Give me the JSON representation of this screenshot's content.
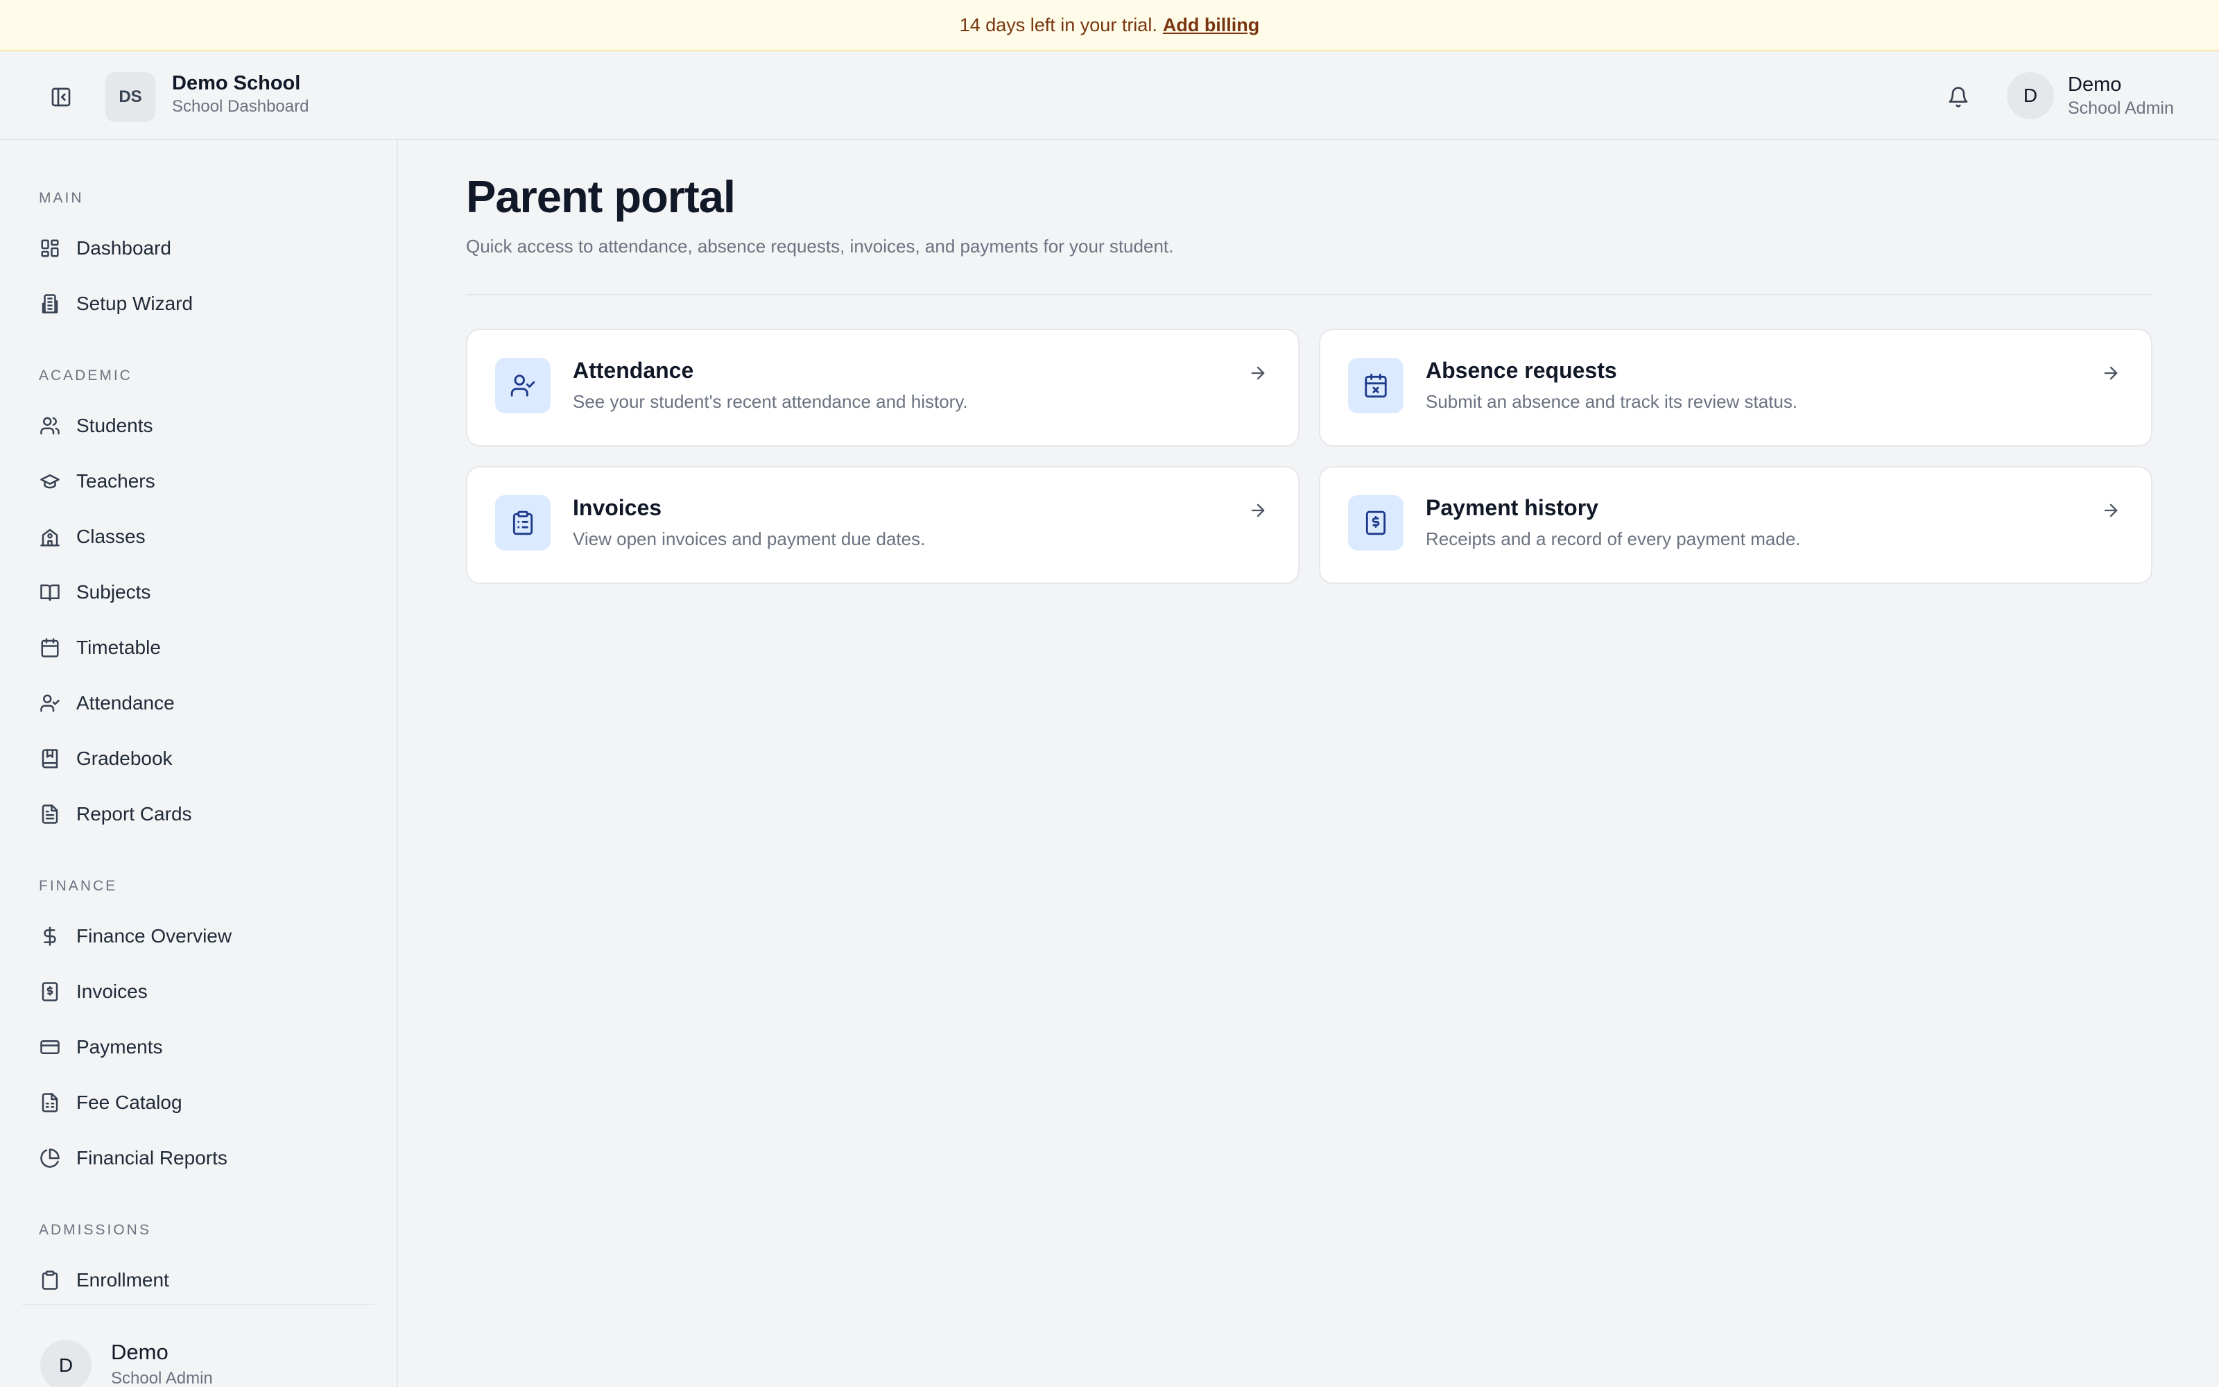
{
  "banner": {
    "text": "14 days left in your trial.",
    "link": "Add billing"
  },
  "header": {
    "collapse_icon": "sidebar-collapse-icon",
    "school_initials": "DS",
    "school_name": "Demo School",
    "school_subtitle": "School Dashboard",
    "bell_icon": "bell-icon",
    "user_initial": "D",
    "user_name": "Demo",
    "user_role": "School Admin"
  },
  "sidebar": {
    "sections": [
      {
        "label": "MAIN",
        "items": [
          {
            "label": "Dashboard",
            "icon": "dashboard-icon"
          },
          {
            "label": "Setup Wizard",
            "icon": "building-icon"
          }
        ]
      },
      {
        "label": "ACADEMIC",
        "items": [
          {
            "label": "Students",
            "icon": "users-icon"
          },
          {
            "label": "Teachers",
            "icon": "graduation-cap-icon"
          },
          {
            "label": "Classes",
            "icon": "school-icon"
          },
          {
            "label": "Subjects",
            "icon": "book-open-icon"
          },
          {
            "label": "Timetable",
            "icon": "calendar-icon"
          },
          {
            "label": "Attendance",
            "icon": "user-check-icon"
          },
          {
            "label": "Gradebook",
            "icon": "bookmark-book-icon"
          },
          {
            "label": "Report Cards",
            "icon": "file-text-icon"
          }
        ]
      },
      {
        "label": "FINANCE",
        "items": [
          {
            "label": "Finance Overview",
            "icon": "dollar-icon"
          },
          {
            "label": "Invoices",
            "icon": "receipt-icon"
          },
          {
            "label": "Payments",
            "icon": "credit-card-icon"
          },
          {
            "label": "Fee Catalog",
            "icon": "file-spreadsheet-icon"
          },
          {
            "label": "Financial Reports",
            "icon": "pie-chart-icon"
          }
        ]
      },
      {
        "label": "ADMISSIONS",
        "items": [
          {
            "label": "Enrollment",
            "icon": "clipboard-icon"
          }
        ]
      }
    ],
    "footer": {
      "initial": "D",
      "name": "Demo",
      "role": "School Admin"
    }
  },
  "main": {
    "title": "Parent portal",
    "description": "Quick access to attendance, absence requests, invoices, and payments for your student.",
    "cards": [
      {
        "title": "Attendance",
        "description": "See your student's recent attendance and history.",
        "icon": "user-check-icon"
      },
      {
        "title": "Absence requests",
        "description": "Submit an absence and track its review status.",
        "icon": "calendar-x-icon"
      },
      {
        "title": "Invoices",
        "description": "View open invoices and payment due dates.",
        "icon": "clipboard-list-icon"
      },
      {
        "title": "Payment history",
        "description": "Receipts and a record of every payment made.",
        "icon": "receipt-dollar-icon"
      }
    ]
  },
  "colors": {
    "banner_bg": "#fefce8",
    "banner_text": "#78350f",
    "page_bg": "#f3f4f6",
    "card_icon_bg": "#dbeafe",
    "card_icon_stroke": "#1e3a8a"
  }
}
